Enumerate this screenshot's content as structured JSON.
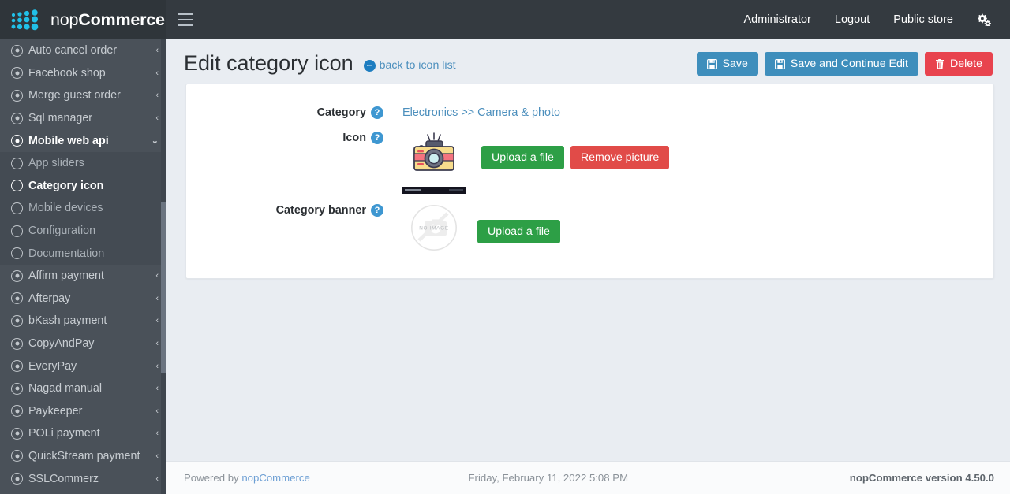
{
  "brand": {
    "text_light": "nop",
    "text_bold": "Commerce",
    "logo_icon": "dots-grid-logo"
  },
  "navbar": {
    "menu_toggle_icon": "hamburger-icon",
    "user_label": "Administrator",
    "logout_label": "Logout",
    "public_store_label": "Public store",
    "settings_icon": "cogs-icon"
  },
  "sidebar": {
    "items": [
      {
        "label": "Auto cancel order",
        "icon": "radio-filled-icon",
        "caret": "‹",
        "active": false
      },
      {
        "label": "Facebook shop",
        "icon": "radio-filled-icon",
        "caret": "‹",
        "active": false
      },
      {
        "label": "Merge guest order",
        "icon": "radio-filled-icon",
        "caret": "‹",
        "active": false
      },
      {
        "label": "Sql manager",
        "icon": "radio-filled-icon",
        "caret": "‹",
        "active": false
      },
      {
        "label": "Mobile web api",
        "icon": "radio-filled-icon",
        "caret": "⌄",
        "active": true
      },
      {
        "label": "Affirm payment",
        "icon": "radio-filled-icon",
        "caret": "‹",
        "active": false
      },
      {
        "label": "Afterpay",
        "icon": "radio-filled-icon",
        "caret": "‹",
        "active": false
      },
      {
        "label": "bKash payment",
        "icon": "radio-filled-icon",
        "caret": "‹",
        "active": false
      },
      {
        "label": "CopyAndPay",
        "icon": "radio-filled-icon",
        "caret": "‹",
        "active": false
      },
      {
        "label": "EveryPay",
        "icon": "radio-filled-icon",
        "caret": "‹",
        "active": false
      },
      {
        "label": "Nagad manual",
        "icon": "radio-filled-icon",
        "caret": "‹",
        "active": false
      },
      {
        "label": "Paykeeper",
        "icon": "radio-filled-icon",
        "caret": "‹",
        "active": false
      },
      {
        "label": "POLi payment",
        "icon": "radio-filled-icon",
        "caret": "‹",
        "active": false
      },
      {
        "label": "QuickStream payment",
        "icon": "radio-filled-icon",
        "caret": "‹",
        "active": false
      },
      {
        "label": "SSLCommerz",
        "icon": "radio-filled-icon",
        "caret": "‹",
        "active": false
      }
    ],
    "submenu": [
      {
        "label": "App sliders",
        "icon": "radio-empty-icon",
        "active": false
      },
      {
        "label": "Category icon",
        "icon": "radio-empty-icon",
        "active": true
      },
      {
        "label": "Mobile devices",
        "icon": "radio-empty-icon",
        "active": false
      },
      {
        "label": "Configuration",
        "icon": "radio-empty-icon",
        "active": false
      },
      {
        "label": "Documentation",
        "icon": "radio-empty-icon",
        "active": false
      }
    ]
  },
  "page": {
    "title": "Edit category icon",
    "back_link": {
      "label": "back to icon list",
      "icon": "arrow-circle-left-icon"
    },
    "actions": [
      {
        "label": "Save",
        "icon": "floppy-save-icon",
        "style": "primary"
      },
      {
        "label": "Save and Continue Edit",
        "icon": "floppy-save-icon",
        "style": "primary"
      },
      {
        "label": "Delete",
        "icon": "trash-icon",
        "style": "danger"
      }
    ]
  },
  "form": {
    "category": {
      "label": "Category",
      "help_icon": "question-circle-icon",
      "value": "Electronics >> Camera & photo"
    },
    "icon": {
      "label": "Icon",
      "help_icon": "question-circle-icon",
      "thumbnail_icon": "camera-illustration",
      "upload_label": "Upload a file",
      "remove_label": "Remove picture"
    },
    "banner": {
      "label": "Category banner",
      "help_icon": "question-circle-icon",
      "placeholder_icon": "no-image-placeholder",
      "placeholder_text": "NO IMAGE",
      "upload_label": "Upload a file"
    }
  },
  "footer": {
    "powered_by_prefix": "Powered by ",
    "powered_by_link": "nopCommerce",
    "date": "Friday, February 11, 2022 5:08 PM",
    "version": "nopCommerce version 4.50.0"
  },
  "colors": {
    "navbar": "#343a40",
    "sidebar": "#4a5159",
    "accent_blue": "#3e8ebc",
    "danger_red": "#e8434e",
    "success_green": "#2d9f46",
    "link_blue": "#4c8fbd",
    "content_bg": "#e9edf2"
  }
}
